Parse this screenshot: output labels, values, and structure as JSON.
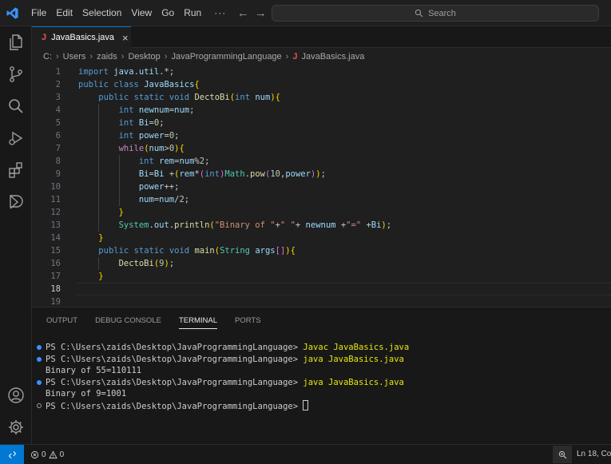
{
  "titlebar": {
    "menu": [
      "File",
      "Edit",
      "Selection",
      "View",
      "Go",
      "Run"
    ],
    "more": "···",
    "back": "←",
    "forward": "→",
    "search_label": "Search"
  },
  "tab": {
    "icon_letter": "J",
    "filename": "JavaBasics.java",
    "close": "×"
  },
  "breadcrumb": [
    "C:",
    "Users",
    "zaids",
    "Desktop",
    "JavaProgrammingLanguage",
    "JavaBasics.java"
  ],
  "breadcrumb_icon": "J",
  "code_lines": [
    {
      "n": "1",
      "text": "import java.util.*;"
    },
    {
      "n": "2",
      "text": "public class JavaBasics{"
    },
    {
      "n": "3",
      "text": "    public static void DectoBi(int num){"
    },
    {
      "n": "4",
      "text": "        int newnum=num;"
    },
    {
      "n": "5",
      "text": "        int Bi=0;"
    },
    {
      "n": "6",
      "text": "        int power=0;"
    },
    {
      "n": "7",
      "text": "        while(num>0){"
    },
    {
      "n": "8",
      "text": "            int rem=num%2;"
    },
    {
      "n": "9",
      "text": "            Bi=Bi +(rem*(int)Math.pow(10,power));"
    },
    {
      "n": "10",
      "text": "            power++;"
    },
    {
      "n": "11",
      "text": "            num=num/2;"
    },
    {
      "n": "12",
      "text": "        }"
    },
    {
      "n": "13",
      "text": "        System.out.println(\"Binary of \"+\" \"+ newnum +\"=\" +Bi);"
    },
    {
      "n": "14",
      "text": "    }"
    },
    {
      "n": "15",
      "text": "    public static void main(String args[]){"
    },
    {
      "n": "16",
      "text": "        DectoBi(9);"
    },
    {
      "n": "17",
      "text": "    }"
    },
    {
      "n": "18",
      "text": ""
    },
    {
      "n": "19",
      "text": ""
    }
  ],
  "panel": {
    "tabs": [
      "OUTPUT",
      "DEBUG CONSOLE",
      "TERMINAL",
      "PORTS"
    ],
    "active_tab": "TERMINAL"
  },
  "terminal": {
    "prompt": "PS C:\\Users\\zaids\\Desktop\\JavaProgrammingLanguage> ",
    "lines": [
      {
        "kind": "cmd",
        "cmd": "Javac JavaBasics.java"
      },
      {
        "kind": "cmd",
        "cmd": "java JavaBasics.java"
      },
      {
        "kind": "out",
        "text": "Binary of 55=110111"
      },
      {
        "kind": "cmd",
        "cmd": "java JavaBasics.java"
      },
      {
        "kind": "out",
        "text": "Binary of 9=1001"
      },
      {
        "kind": "prompt"
      }
    ]
  },
  "statusbar": {
    "remote_icon": "remote-icon",
    "errors": "0",
    "warnings": "0",
    "cursor_position": "Ln 18, Co"
  },
  "colors": {
    "accent": "#0078d4",
    "logo": "#3794ff",
    "java_icon": "#f14c4c"
  }
}
